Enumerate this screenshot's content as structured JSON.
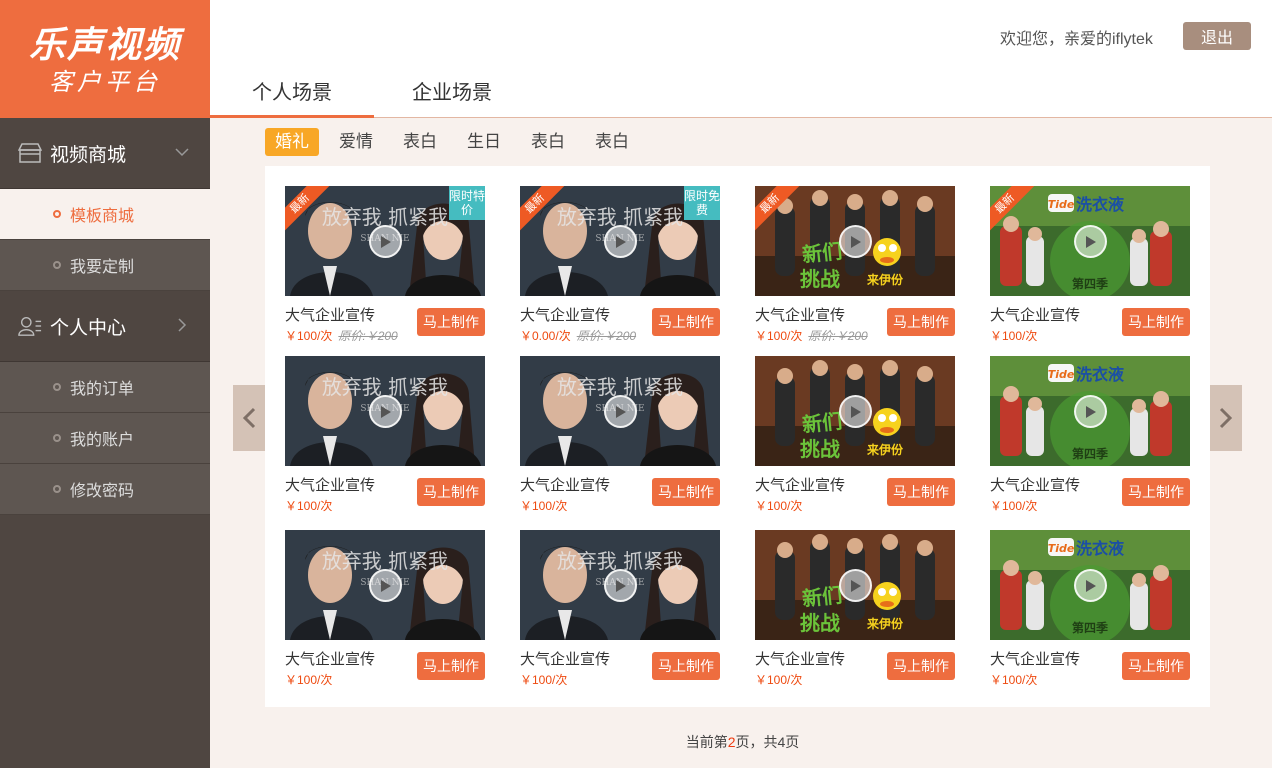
{
  "logo": {
    "line1": "乐声视频",
    "line2": "客户平台"
  },
  "header": {
    "welcome": "欢迎您，亲爱的iflytek",
    "logout_label": "退出"
  },
  "sidebar": {
    "group1": {
      "label": "视频商城",
      "icon": "store-icon"
    },
    "group1_items": [
      {
        "label": "模板商城",
        "active": true
      },
      {
        "label": "我要定制"
      }
    ],
    "group2": {
      "label": "个人中心",
      "icon": "user-icon"
    },
    "group2_items": [
      {
        "label": "我的订单"
      },
      {
        "label": "我的账户"
      },
      {
        "label": "修改密码"
      }
    ]
  },
  "main_tabs": [
    {
      "label": "个人场景",
      "active": true
    },
    {
      "label": "企业场景"
    }
  ],
  "sub_tabs": [
    {
      "label": "婚礼",
      "active": true
    },
    {
      "label": "爱情"
    },
    {
      "label": "表白"
    },
    {
      "label": "生日"
    },
    {
      "label": "表白"
    },
    {
      "label": "表白"
    }
  ],
  "cards": [
    {
      "title": "大气企业宣传",
      "price": "￥100/次",
      "orig": "原价:￥200",
      "badge": "最新",
      "promo": "限时特价",
      "thumb": "poster-a",
      "button": "马上制作"
    },
    {
      "title": "大气企业宣传",
      "price": "￥0.00/次",
      "orig": "原价:￥200",
      "badge": "最新",
      "promo": "限时免费",
      "thumb": "poster-a",
      "button": "马上制作"
    },
    {
      "title": "大气企业宣传",
      "price": "￥100/次",
      "orig": "原价:￥200",
      "badge": "最新",
      "promo": "",
      "thumb": "poster-b",
      "button": "马上制作"
    },
    {
      "title": "大气企业宣传",
      "price": "￥100/次",
      "orig": "",
      "badge": "最新",
      "promo": "",
      "thumb": "poster-c",
      "button": "马上制作"
    },
    {
      "title": "大气企业宣传",
      "price": "￥100/次",
      "orig": "",
      "badge": "",
      "promo": "",
      "thumb": "poster-a",
      "button": "马上制作"
    },
    {
      "title": "大气企业宣传",
      "price": "￥100/次",
      "orig": "",
      "badge": "",
      "promo": "",
      "thumb": "poster-a",
      "button": "马上制作"
    },
    {
      "title": "大气企业宣传",
      "price": "￥100/次",
      "orig": "",
      "badge": "",
      "promo": "",
      "thumb": "poster-b",
      "button": "马上制作"
    },
    {
      "title": "大气企业宣传",
      "price": "￥100/次",
      "orig": "",
      "badge": "",
      "promo": "",
      "thumb": "poster-c",
      "button": "马上制作"
    },
    {
      "title": "大气企业宣传",
      "price": "￥100/次",
      "orig": "",
      "badge": "",
      "promo": "",
      "thumb": "poster-a",
      "button": "马上制作"
    },
    {
      "title": "大气企业宣传",
      "price": "￥100/次",
      "orig": "",
      "badge": "",
      "promo": "",
      "thumb": "poster-a",
      "button": "马上制作"
    },
    {
      "title": "大气企业宣传",
      "price": "￥100/次",
      "orig": "",
      "badge": "",
      "promo": "",
      "thumb": "poster-b",
      "button": "马上制作"
    },
    {
      "title": "大气企业宣传",
      "price": "￥100/次",
      "orig": "",
      "badge": "",
      "promo": "",
      "thumb": "poster-c",
      "button": "马上制作"
    }
  ],
  "thumb_text": {
    "poster_a": "放弃我 抓紧我",
    "poster_a_sub": "SHAN NIE",
    "poster_b_1": "新们",
    "poster_b_2": "挑战",
    "poster_b_3": "来伊份",
    "poster_c_brand": "Tide",
    "poster_c_1": "洗衣液",
    "poster_c_2": "第四季"
  },
  "pager": {
    "prefix": "当前第",
    "current": "2",
    "middle": "页，共",
    "total": "4",
    "suffix": "页"
  },
  "colors": {
    "accent": "#ee6d3f",
    "sidebar": "#4f4641",
    "promo": "#45bcc0",
    "active_sub_tab": "#f8a726"
  }
}
